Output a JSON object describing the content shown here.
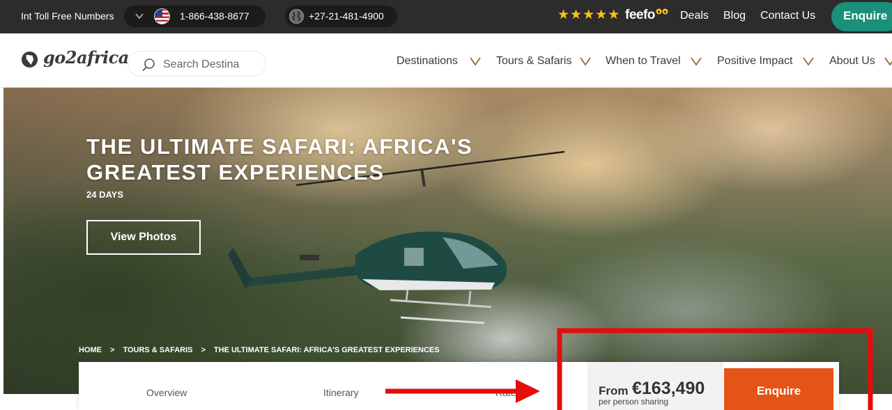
{
  "topbar": {
    "toll_label": "Int Toll Free Numbers",
    "us_number": "1-866-438-8677",
    "za_number": "+27-21-481-4900",
    "rating_stars": 5,
    "star_glyph": "★",
    "feefo_brand": "feefo",
    "links": {
      "deals": "Deals",
      "blog": "Blog",
      "contact": "Contact Us"
    },
    "enquire": "Enquire"
  },
  "header": {
    "logo_text": "go2africa",
    "search_placeholder": "Search Destina",
    "nav": [
      "Destinations",
      "Tours & Safaris",
      "When to Travel",
      "Positive Impact",
      "About Us"
    ]
  },
  "hero": {
    "title": "THE ULTIMATE SAFARI: AFRICA'S GREATEST EXPERIENCES",
    "duration": "24 DAYS",
    "view_photos": "View Photos",
    "breadcrumb": [
      "HOME",
      ">",
      "TOURS & SAFARIS",
      ">",
      "THE ULTIMATE SAFARI: AFRICA'S GREATEST EXPERIENCES"
    ]
  },
  "tabs": [
    "Overview",
    "Itinerary",
    "Rates"
  ],
  "price": {
    "from": "From",
    "amount": "€163,490",
    "note": "per person sharing"
  },
  "enquire_main": "Enquire",
  "colors": {
    "topbar_bg": "#2c2c2c",
    "teal_accent": "#1a8f7a",
    "orange_cta": "#e35416",
    "star": "#ffc21a",
    "annotation_red": "#e30d0d"
  },
  "icons": [
    "chevron-down-icon",
    "us-flag-icon",
    "globe-icon",
    "star-icon",
    "go2africa-logo-icon",
    "search-icon",
    "helicopter-image"
  ]
}
